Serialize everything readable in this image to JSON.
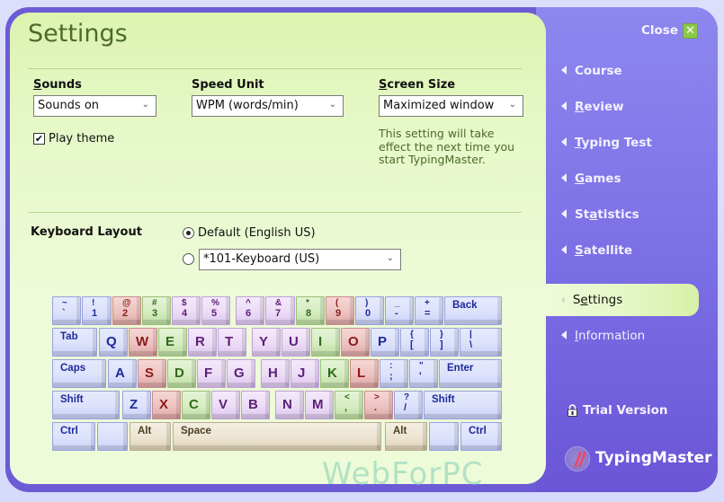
{
  "header": {
    "title": "Settings"
  },
  "sounds": {
    "label_first": "S",
    "label_rest": "ounds",
    "value": "Sounds on",
    "play_theme_label": "Play theme",
    "play_theme_checked": true
  },
  "speed_unit": {
    "label": "Speed Unit",
    "value": "WPM (words/min)"
  },
  "screen_size": {
    "label_first": "S",
    "label_rest": "creen Size",
    "value": "Maximized window",
    "note_lines": [
      "This setting will take",
      "effect the next time you",
      "start TypingMaster."
    ]
  },
  "keyboard_layout": {
    "label": "Keyboard Layout",
    "option_default": "Default (English US)",
    "option_default_selected": true,
    "option_custom_value": "*101-Keyboard (US)",
    "option_custom_selected": false
  },
  "keyboard": {
    "rows": [
      [
        {
          "t": "~",
          "b": "`",
          "c": "blue"
        },
        {
          "t": "!",
          "b": "1",
          "c": "blue"
        },
        {
          "t": "@",
          "b": "2",
          "c": "red"
        },
        {
          "t": "#",
          "b": "3",
          "c": "green"
        },
        {
          "t": "$",
          "b": "4",
          "c": "purple"
        },
        {
          "t": "%",
          "b": "5",
          "c": "purple"
        },
        {
          "t": "^",
          "b": "6",
          "c": "purple"
        },
        {
          "t": "&",
          "b": "7",
          "c": "purple"
        },
        {
          "t": "*",
          "b": "8",
          "c": "green"
        },
        {
          "t": "(",
          "b": "9",
          "c": "red"
        },
        {
          "t": ")",
          "b": "0",
          "c": "blue"
        },
        {
          "t": "_",
          "b": "-",
          "c": "blue"
        },
        {
          "t": "+",
          "b": "=",
          "c": "blue"
        },
        {
          "w": "Back",
          "c": "blue"
        }
      ],
      [
        {
          "w": "Tab",
          "c": "blue"
        },
        {
          "m": "Q",
          "c": "blue"
        },
        {
          "m": "W",
          "c": "red"
        },
        {
          "m": "E",
          "c": "green"
        },
        {
          "m": "R",
          "c": "purple"
        },
        {
          "m": "T",
          "c": "purple"
        },
        {
          "m": "Y",
          "c": "purple"
        },
        {
          "m": "U",
          "c": "purple"
        },
        {
          "m": "I",
          "c": "green"
        },
        {
          "m": "O",
          "c": "red"
        },
        {
          "m": "P",
          "c": "blue"
        },
        {
          "t": "{",
          "b": "[",
          "c": "blue"
        },
        {
          "t": "}",
          "b": "]",
          "c": "blue"
        },
        {
          "t": "|",
          "b": "\\",
          "c": "blue"
        }
      ],
      [
        {
          "w": "Caps",
          "c": "blue"
        },
        {
          "m": "A",
          "c": "blue"
        },
        {
          "m": "S",
          "c": "red"
        },
        {
          "m": "D",
          "c": "green"
        },
        {
          "m": "F",
          "c": "purple"
        },
        {
          "m": "G",
          "c": "purple"
        },
        {
          "m": "H",
          "c": "purple"
        },
        {
          "m": "J",
          "c": "purple"
        },
        {
          "m": "K",
          "c": "green"
        },
        {
          "m": "L",
          "c": "red"
        },
        {
          "t": ":",
          "b": ";",
          "c": "blue"
        },
        {
          "t": "\"",
          "b": "'",
          "c": "blue"
        },
        {
          "w": "Enter",
          "c": "blue"
        }
      ],
      [
        {
          "w": "Shift",
          "c": "blue"
        },
        {
          "m": "Z",
          "c": "blue"
        },
        {
          "m": "X",
          "c": "red"
        },
        {
          "m": "C",
          "c": "green"
        },
        {
          "m": "V",
          "c": "purple"
        },
        {
          "m": "B",
          "c": "purple"
        },
        {
          "m": "N",
          "c": "purple"
        },
        {
          "m": "M",
          "c": "purple"
        },
        {
          "t": "<",
          "b": ",",
          "c": "green"
        },
        {
          "t": ">",
          "b": ".",
          "c": "red"
        },
        {
          "t": "?",
          "b": "/",
          "c": "blue"
        },
        {
          "w": "Shift",
          "c": "blue"
        }
      ],
      [
        {
          "w": "Ctrl",
          "c": "blue"
        },
        {
          "w": "",
          "c": "blue"
        },
        {
          "w": "Alt",
          "c": "tan"
        },
        {
          "w": "Space",
          "c": "tan"
        },
        {
          "w": "Alt",
          "c": "tan"
        },
        {
          "w": "",
          "c": "blue"
        },
        {
          "w": "Ctrl",
          "c": "blue"
        }
      ]
    ]
  },
  "nav": {
    "close_label": "Close",
    "items": [
      {
        "label": "Course",
        "ul": -1
      },
      {
        "label": "Review",
        "ul": 0
      },
      {
        "label": "Typing Test",
        "ul": 0
      },
      {
        "label": "Games",
        "ul": 0
      },
      {
        "label": "Statistics",
        "ul": 2
      },
      {
        "label": "Satellite",
        "ul": 0
      }
    ],
    "active": {
      "label": "Settings",
      "ul": 1
    },
    "after": [
      {
        "label": "Information",
        "ul": 0
      }
    ],
    "trial_label": "Trial Version",
    "brand": "TypingMaster"
  },
  "watermark": "WebForPC",
  "colors": {
    "frame": "#6d5bd6",
    "panel": "#eefad8",
    "close_button": "#8cc94a"
  }
}
